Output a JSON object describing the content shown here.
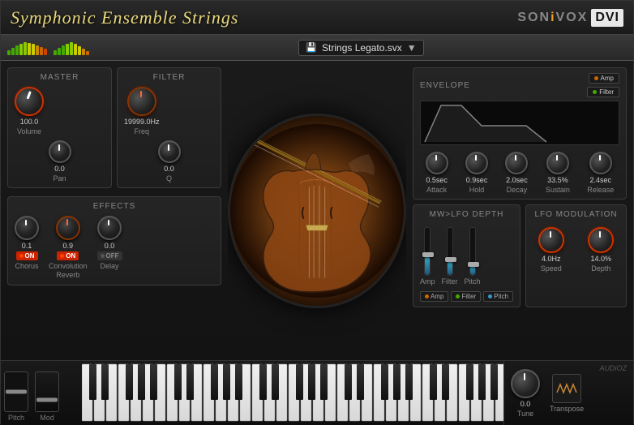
{
  "header": {
    "title": "Symphonic Ensemble Strings",
    "brand": "SONiVOX",
    "dvi": "DVI"
  },
  "toolbar": {
    "preset": "Strings Legato.svx"
  },
  "master": {
    "label": "MASTER",
    "volume_val": "100.0",
    "volume_name": "Volume",
    "pan_val": "0.0",
    "pan_name": "Pan"
  },
  "filter": {
    "label": "FILTER",
    "freq_val": "19999.0Hz",
    "freq_name": "Freq",
    "q_val": "0.0",
    "q_name": "Q"
  },
  "effects": {
    "label": "EFFECTS",
    "chorus_val": "0.1",
    "chorus_name": "Chorus",
    "chorus_on": "ON",
    "reverb_val": "0.9",
    "reverb_name": "Convolution\nReverb",
    "reverb_on": "ON",
    "delay_val": "0.0",
    "delay_name": "Delay",
    "delay_on": "OFF"
  },
  "envelope": {
    "label": "ENVELOPE",
    "amp_btn": "Amp",
    "filter_btn": "Filter",
    "attack_val": "0.5sec",
    "attack_name": "Attack",
    "hold_val": "0.9sec",
    "hold_name": "Hold",
    "decay_val": "2.0sec",
    "decay_name": "Decay",
    "sustain_val": "33.5%",
    "sustain_name": "Sustain",
    "release_val": "2.4sec",
    "release_name": "Release"
  },
  "mw_lfo": {
    "label": "MW>LFO DEPTH",
    "amp_label": "Amp",
    "filter_label": "Filter",
    "pitch_label": "Pitch",
    "amp_btn": "Amp",
    "filter_btn": "Filter",
    "pitch_btn": "Pitch"
  },
  "lfo_mod": {
    "label": "LFO MODULATION",
    "speed_val": "4.0Hz",
    "speed_name": "Speed",
    "depth_val": "14.0%",
    "depth_name": "Depth"
  },
  "keyboard": {
    "pitch_label": "Pitch",
    "mod_label": "Mod",
    "tune_val": "0.0",
    "tune_name": "Tune",
    "transpose_name": "Transpose"
  },
  "colors": {
    "accent_red": "#cc3300",
    "accent_orange": "#cc6600",
    "accent_green": "#44aa00",
    "accent_blue": "#33aacc",
    "knob_red": "#cc2200",
    "text_light": "#cccccc",
    "text_dim": "#888888",
    "bg_dark": "#1a1a1a",
    "bg_medium": "#252525"
  }
}
